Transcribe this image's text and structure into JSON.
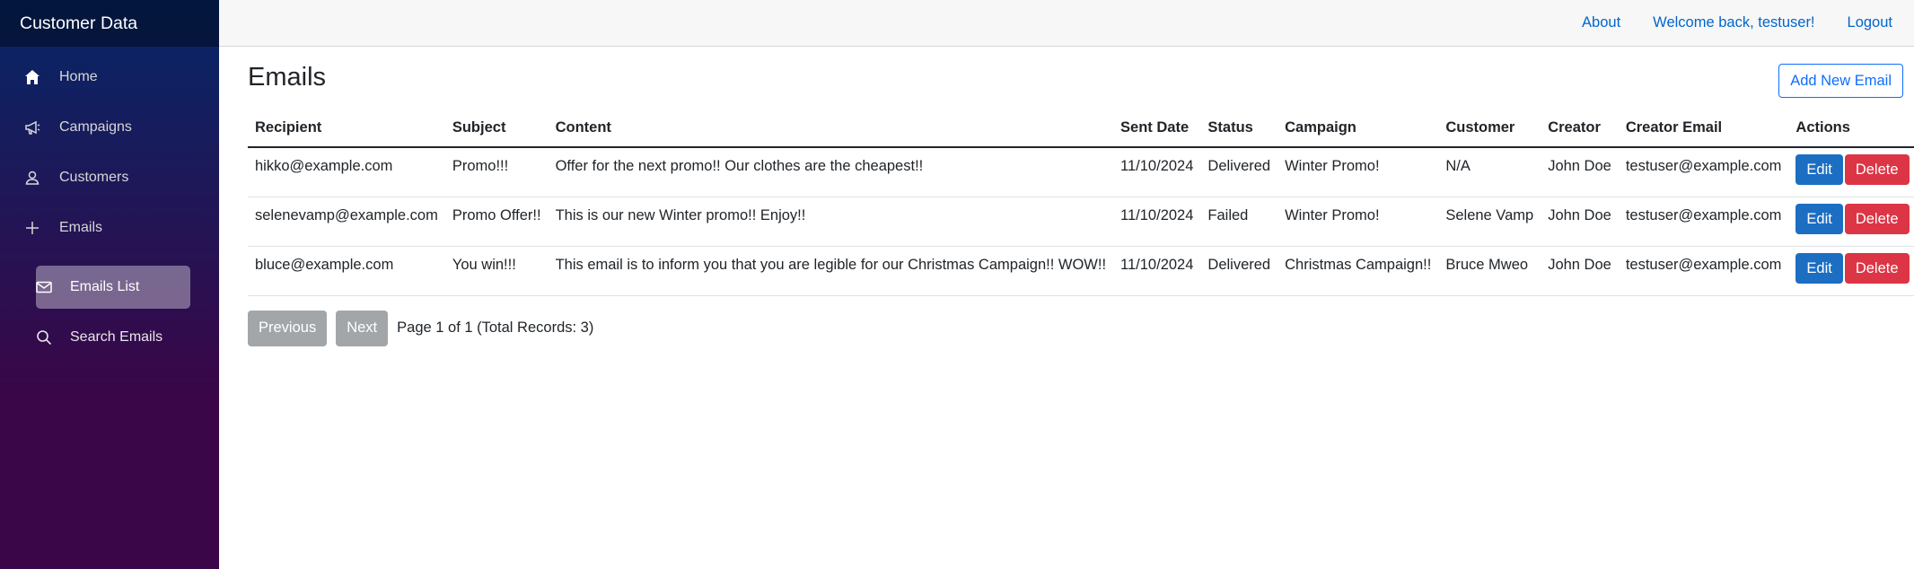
{
  "app": {
    "brand": "Customer Data"
  },
  "sidebar": {
    "items": [
      {
        "label": "Home",
        "icon": "home-icon"
      },
      {
        "label": "Campaigns",
        "icon": "megaphone-icon"
      },
      {
        "label": "Customers",
        "icon": "person-icon"
      },
      {
        "label": "Emails",
        "icon": "plus-icon"
      }
    ],
    "subitems": [
      {
        "label": "Emails List",
        "icon": "envelope-icon",
        "active": true
      },
      {
        "label": "Search Emails",
        "icon": "search-icon",
        "active": false
      }
    ]
  },
  "topbar": {
    "about": "About",
    "welcome": "Welcome back, testuser!",
    "logout": "Logout"
  },
  "page": {
    "title": "Emails",
    "add_button": "Add New Email"
  },
  "table": {
    "headers": [
      "Recipient",
      "Subject",
      "Content",
      "Sent Date",
      "Status",
      "Campaign",
      "Customer",
      "Creator",
      "Creator Email",
      "Actions"
    ],
    "rows": [
      [
        "hikko@example.com",
        "Promo!!!",
        "Offer for the next promo!! Our clothes are the cheapest!!",
        "11/10/2024",
        "Delivered",
        "Winter Promo!",
        "N/A",
        "John Doe",
        "testuser@example.com"
      ],
      [
        "selenevamp@example.com",
        "Promo Offer!!",
        "This is our new Winter promo!! Enjoy!!",
        "11/10/2024",
        "Failed",
        "Winter Promo!",
        "Selene Vamp",
        "John Doe",
        "testuser@example.com"
      ],
      [
        "bluce@example.com",
        "You win!!!",
        "This email is to inform you that you are legible for our Christmas Campaign!! WOW!!",
        "11/10/2024",
        "Delivered",
        "Christmas Campaign!!",
        "Bruce Mweo",
        "John Doe",
        "testuser@example.com"
      ]
    ],
    "edit_label": "Edit",
    "delete_label": "Delete"
  },
  "pagination": {
    "previous": "Previous",
    "next": "Next",
    "info": "Page 1 of 1 (Total Records: 3)"
  },
  "colors": {
    "accent": "#0d6efd",
    "edit": "#1b6ec2",
    "delete": "#dc3545",
    "muted": "#a3a6a9"
  }
}
